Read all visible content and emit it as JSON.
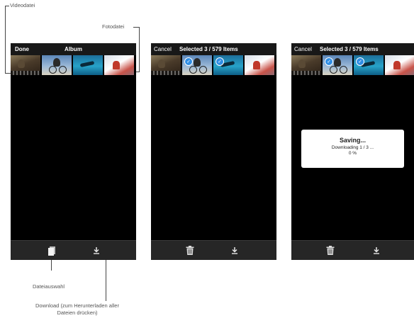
{
  "annotations": {
    "videodatei": "Videodatei",
    "fotodatei": "Fotodatei",
    "dateiauswahl": "Dateiauswahl",
    "download_line1": "Download (zum Herunterladen aller",
    "download_line2": "Dateien drücken)"
  },
  "screen1": {
    "done_label": "Done",
    "title": "Album"
  },
  "screen2": {
    "cancel_label": "Cancel",
    "selected_label": "Selected 3 / 579 Items"
  },
  "screen3": {
    "cancel_label": "Cancel",
    "selected_label": "Selected 3 / 579 Items",
    "dialog": {
      "title": "Saving...",
      "message": "Downloading 1 / 3 ...",
      "percent": "0 %"
    }
  },
  "icons": {
    "checkmark": "✓"
  },
  "colors": {
    "screen_bg": "#000000",
    "toolbar_bg": "#262626",
    "check_blue": "#2f8ee5"
  }
}
